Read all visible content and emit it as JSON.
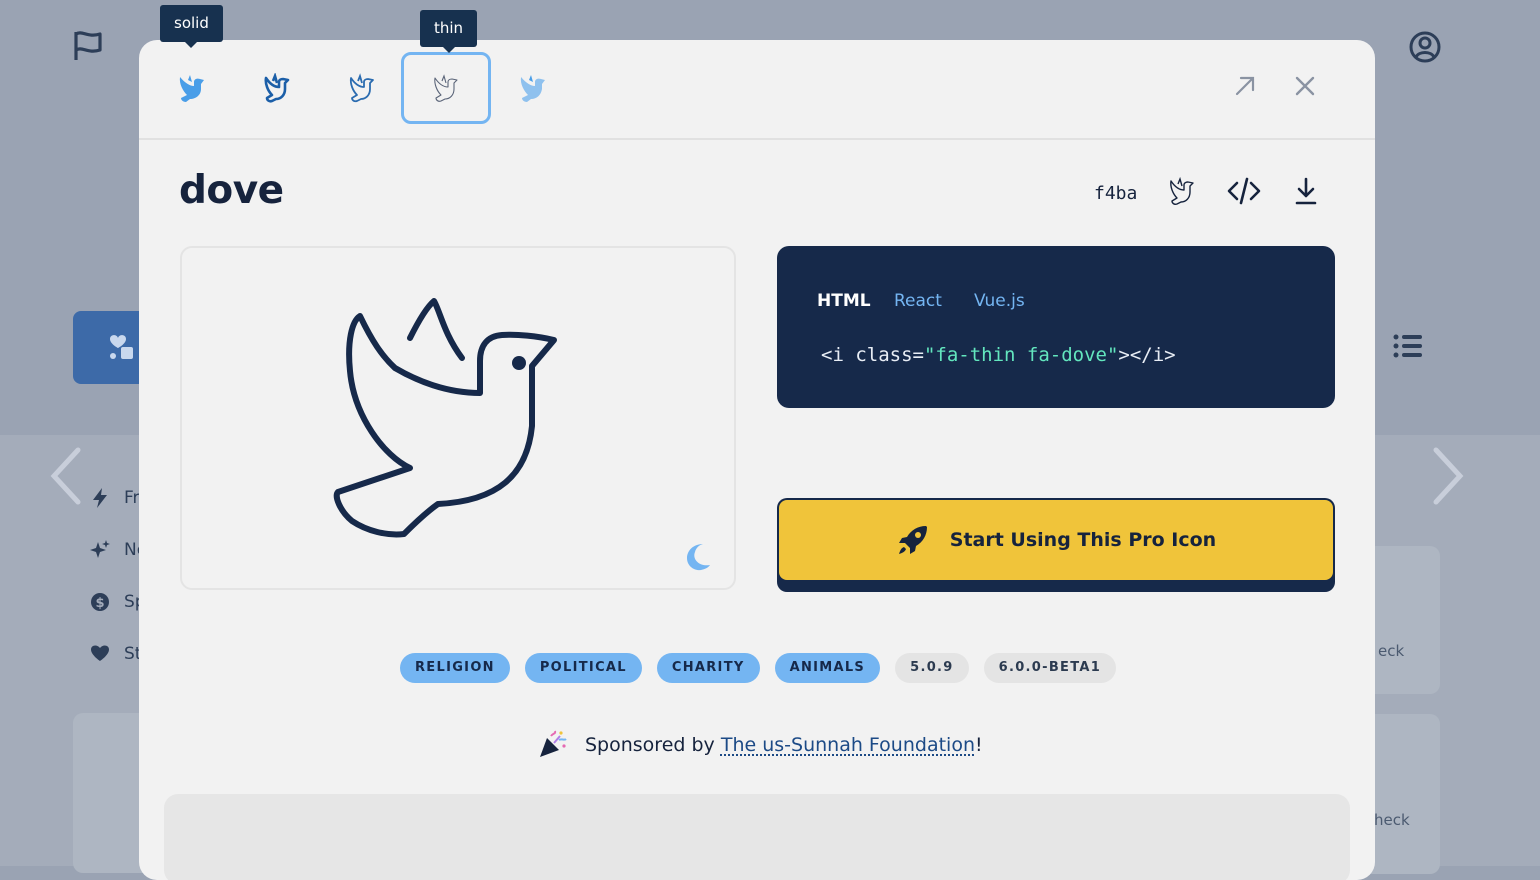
{
  "page": {
    "background_color": "#9aa3b3",
    "accent_color": "#74b5f2",
    "navy_color": "#16294a",
    "cta_color": "#f0c43a"
  },
  "background": {
    "sidebar_items": [
      {
        "icon": "bolt-icon",
        "label": "Fr"
      },
      {
        "icon": "sparkles-icon",
        "label": "Ne"
      },
      {
        "icon": "dollar-icon",
        "label": "Sp"
      },
      {
        "icon": "heart-icon",
        "label": "St"
      }
    ],
    "card_labels": [
      "eck",
      "heck"
    ]
  },
  "modal": {
    "style_tabs": [
      {
        "name": "solid",
        "active": false
      },
      {
        "name": "regular",
        "active": false
      },
      {
        "name": "light",
        "active": false
      },
      {
        "name": "thin",
        "active": true
      },
      {
        "name": "duotone",
        "active": false
      }
    ],
    "tooltips": {
      "solid": "solid",
      "thin": "thin"
    },
    "icon_name": "dove",
    "unicode": "f4ba",
    "code": {
      "tabs": [
        "HTML",
        "React",
        "Vue.js"
      ],
      "active_tab": "HTML",
      "prefix": "<i class=",
      "class_string": "\"fa-thin fa-dove\"",
      "suffix": "></i>"
    },
    "cta_label": "Start Using This Pro Icon",
    "tags": [
      {
        "label": "RELIGION",
        "kind": "category"
      },
      {
        "label": "POLITICAL",
        "kind": "category"
      },
      {
        "label": "CHARITY",
        "kind": "category"
      },
      {
        "label": "ANIMALS",
        "kind": "category"
      },
      {
        "label": "5.0.9",
        "kind": "version"
      },
      {
        "label": "6.0.0-BETA1",
        "kind": "version"
      }
    ],
    "sponsor": {
      "prefix": "Sponsored by ",
      "link_text": "The us-Sunnah Foundation",
      "suffix": "!"
    }
  }
}
